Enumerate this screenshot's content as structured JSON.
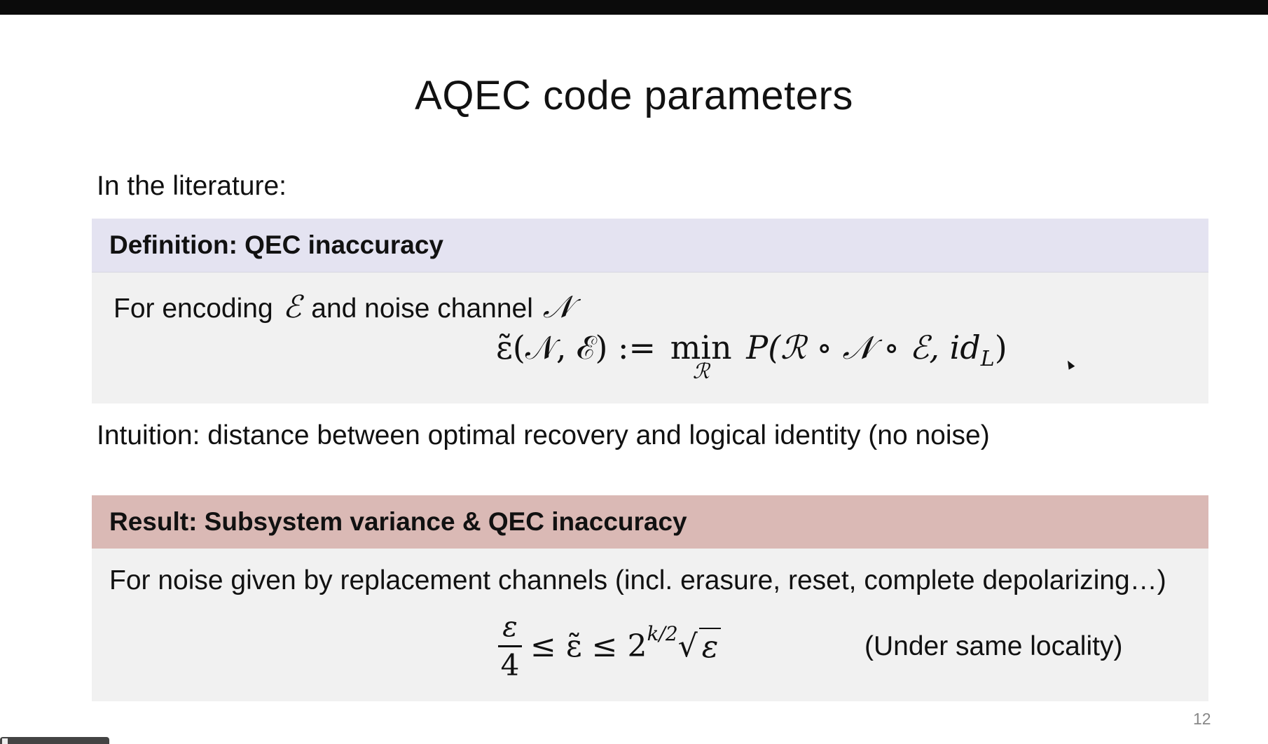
{
  "slide": {
    "title": "AQEC code parameters",
    "intro": "In the literature:",
    "page_number": "12"
  },
  "definition": {
    "header": "Definition: QEC inaccuracy",
    "text_pre": "For encoding",
    "text_mid": "and noise channel",
    "symbol_encoding": "ℰ",
    "symbol_noise": "𝒩",
    "formula": {
      "lhs": "ε̃(𝒩, ℰ) :=",
      "min": "min",
      "min_sub": "ℛ",
      "rhs_main": "P(ℛ ∘ 𝒩 ∘ ℰ, id",
      "rhs_sub": "L",
      "rhs_close": ")"
    }
  },
  "intuition": "Intuition: distance between optimal recovery and logical identity (no noise)",
  "result": {
    "header": "Result: Subsystem variance & QEC inaccuracy",
    "text": "For noise given by replacement channels (incl. erasure, reset, complete depolarizing…)",
    "formula": {
      "frac_num": "ε",
      "frac_den": "4",
      "middle": "≤ ε̃ ≤ 2",
      "sup": "k/2",
      "sqrt_sign": "√",
      "sqrt_arg": "ε"
    },
    "note": "(Under same locality)"
  },
  "colors": {
    "definition_header_bg": "#e4e3f1",
    "result_header_bg": "#dab9b5",
    "body_bg": "#f1f1f1",
    "topbar": "#0b0b0b"
  }
}
